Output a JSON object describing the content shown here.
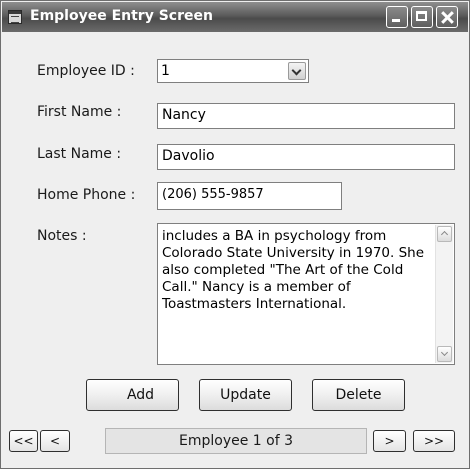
{
  "window": {
    "title": "Employee Entry Screen",
    "icon": "app-form-icon"
  },
  "form": {
    "employee_id": {
      "label": "Employee ID :",
      "value": "1"
    },
    "first_name": {
      "label": "First Name :",
      "value": "Nancy"
    },
    "last_name": {
      "label": "Last Name :",
      "value": "Davolio"
    },
    "home_phone": {
      "label": "Home Phone :",
      "value": "(206) 555-9857"
    },
    "notes": {
      "label": "Notes :",
      "value": "includes a BA in psychology from Colorado State University in 1970. She also completed \"The Art of the Cold Call.\" Nancy is a member of Toastmasters International."
    }
  },
  "buttons": {
    "add": "Add",
    "update": "Update",
    "delete": "Delete"
  },
  "navigator": {
    "first": "<<",
    "prev": "<",
    "status": "Employee 1 of 3",
    "next": ">",
    "last": ">>"
  }
}
